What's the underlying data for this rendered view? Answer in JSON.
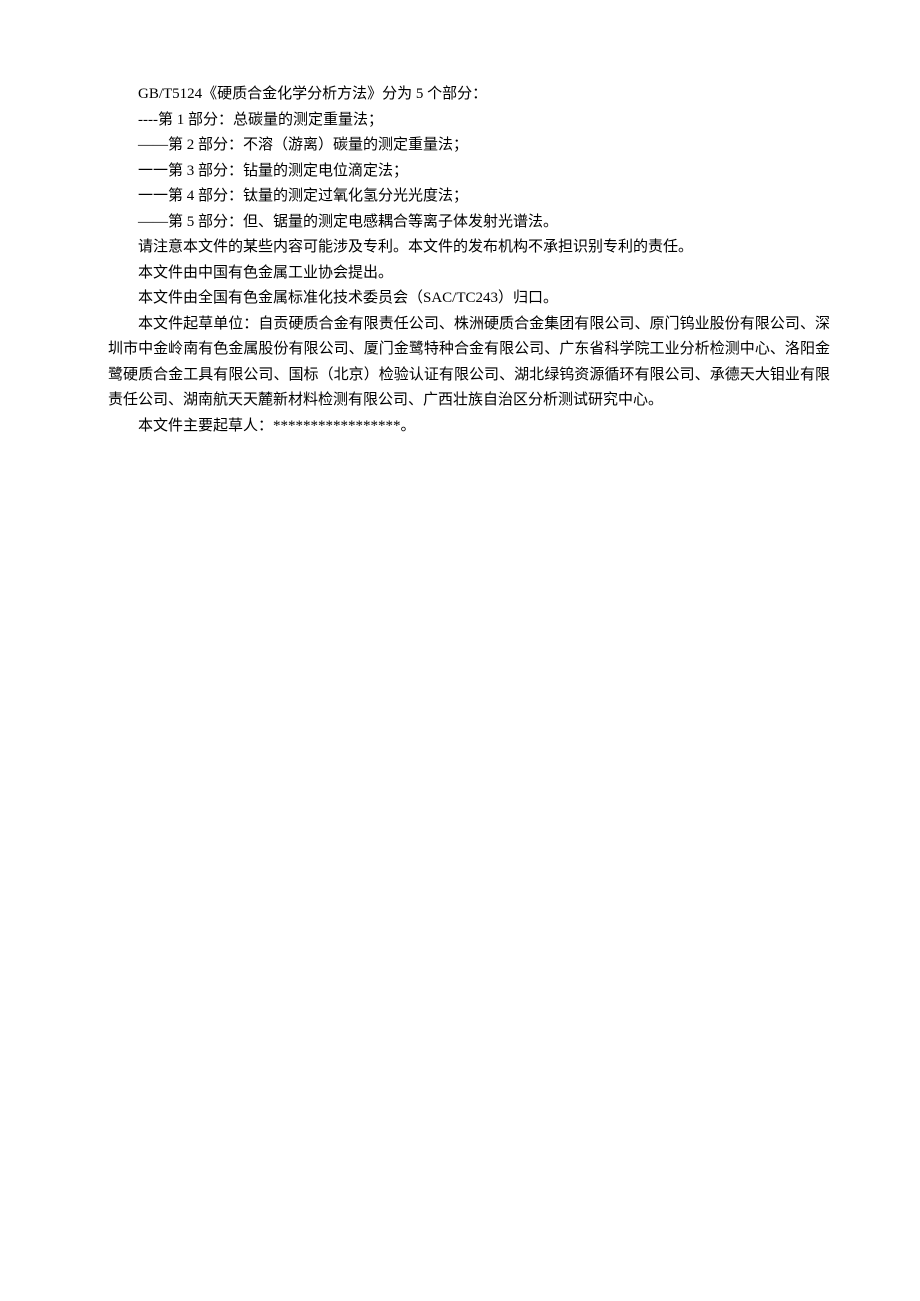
{
  "lines": [
    {
      "text": "GB/T5124《硬质合金化学分析方法》分为 5 个部分：",
      "indent": true
    },
    {
      "text": "----第 1 部分：总碳量的测定重量法；",
      "indent": true
    },
    {
      "text": "——第 2 部分：不溶（游离）碳量的测定重量法；",
      "indent": true
    },
    {
      "text": "一一第 3 部分：钻量的测定电位滴定法；",
      "indent": true
    },
    {
      "text": "一一第 4 部分：钛量的测定过氧化氢分光光度法；",
      "indent": true
    },
    {
      "text": "——第 5 部分：但、锯量的测定电感耦合等离子体发射光谱法。",
      "indent": true
    },
    {
      "text": "请注意本文件的某些内容可能涉及专利。本文件的发布机构不承担识别专利的责任。",
      "indent": true
    },
    {
      "text": "本文件由中国有色金属工业协会提出。",
      "indent": true
    },
    {
      "text": "本文件由全国有色金属标准化技术委员会（SAC/TC243）归口。",
      "indent": true
    },
    {
      "text": "本文件起草单位：自贡硬质合金有限责任公司、株洲硬质合金集团有限公司、原门钨业股份有限公司、深圳市中金岭南有色金属股份有限公司、厦门金鹭特种合金有限公司、广东省科学院工业分析检测中心、洛阳金鹭硬质合金工具有限公司、国标（北京）检验认证有限公司、湖北绿钨资源循环有限公司、承德天大钼业有限责任公司、湖南航天天麓新材料检测有限公司、广西壮族自治区分析测试研究中心。",
      "indent": true
    },
    {
      "text": "本文件主要起草人：*****************。",
      "indent": true
    }
  ]
}
